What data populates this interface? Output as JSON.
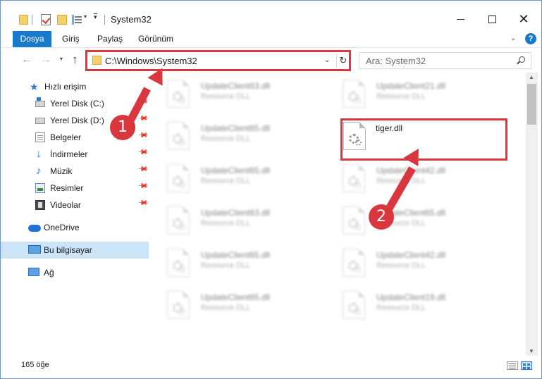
{
  "window": {
    "title": "System32",
    "minimize": "—",
    "maximize": "☐",
    "close": "✕"
  },
  "ribbon": {
    "tabs": [
      "Dosya",
      "Giriş",
      "Paylaş",
      "Görünüm"
    ],
    "help": "?"
  },
  "nav": {
    "address": "C:\\Windows\\System32",
    "search_placeholder": "Ara: System32"
  },
  "sidebar": {
    "items": [
      {
        "label": "Hızlı erişim",
        "icon": "star-icon"
      },
      {
        "label": "Yerel Disk (C:)",
        "icon": "disk-icon",
        "pinned": true
      },
      {
        "label": "Yerel Disk (D:)",
        "icon": "disk-icon",
        "pinned": true
      },
      {
        "label": "Belgeler",
        "icon": "documents-icon",
        "pinned": true
      },
      {
        "label": "İndirmeler",
        "icon": "download-icon",
        "pinned": true
      },
      {
        "label": "Müzik",
        "icon": "music-icon",
        "pinned": true
      },
      {
        "label": "Resimler",
        "icon": "pictures-icon",
        "pinned": true
      },
      {
        "label": "Videolar",
        "icon": "videos-icon",
        "pinned": true
      },
      {
        "label": "OneDrive",
        "icon": "onedrive-icon"
      },
      {
        "label": "Bu bilgisayar",
        "icon": "this-pc-icon",
        "selected": true
      },
      {
        "label": "Ağ",
        "icon": "network-icon"
      }
    ]
  },
  "files": [
    {
      "name": "UpdateClient63.dll",
      "type": "Resource DLL"
    },
    {
      "name": "UpdateClient21.dll",
      "type": "Resource DLL"
    },
    {
      "name": "UpdateClient65.dll",
      "type": "Resource DLL"
    },
    {
      "name": "tiger.dll",
      "type": ""
    },
    {
      "name": "UpdateClient65.dll",
      "type": "Resource DLL"
    },
    {
      "name": "UpdateClient42.dll",
      "type": "Resource DLL"
    },
    {
      "name": "UpdateClient63.dll",
      "type": "Resource DLL"
    },
    {
      "name": "UpdateClient65.dll",
      "type": "Resource DLL"
    },
    {
      "name": "UpdateClient65.dll",
      "type": "Resource DLL"
    },
    {
      "name": "UpdateClient42.dll",
      "type": "Resource DLL"
    },
    {
      "name": "UpdateClient65.dll",
      "type": "Resource DLL"
    },
    {
      "name": "UpdateClient19.dll",
      "type": "Resource DLL"
    }
  ],
  "status": {
    "count_text": "165 öğe"
  },
  "annotations": {
    "step1": "1",
    "step2": "2",
    "color": "#d9373d"
  }
}
